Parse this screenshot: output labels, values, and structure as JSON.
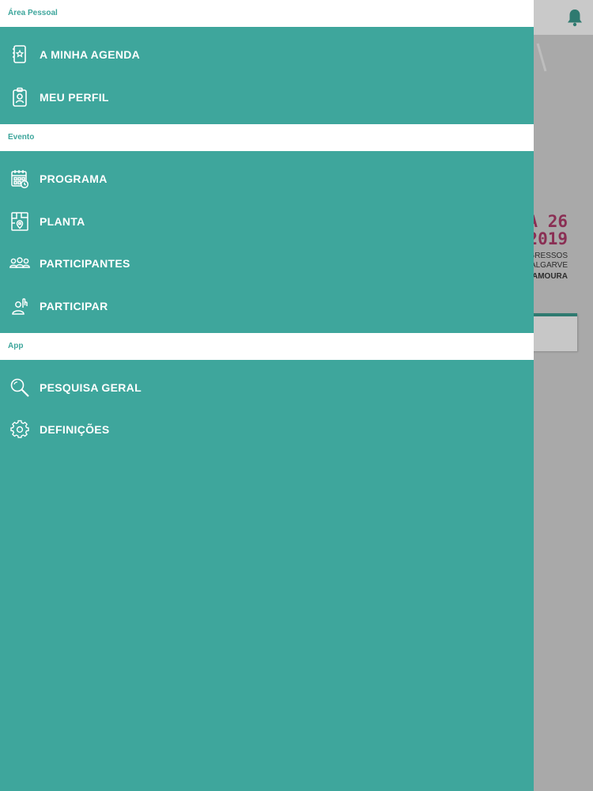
{
  "background": {
    "poster": {
      "line1": "A 26",
      "line2": "2019",
      "line3": "GRESSOS",
      "line4": "ALGARVE",
      "line5": "AMOURA"
    }
  },
  "drawer": {
    "sections": {
      "personal": {
        "header": "Área Pessoal",
        "items": [
          {
            "label": "A MINHA AGENDA",
            "icon": "agenda-icon"
          },
          {
            "label": "MEU PERFIL",
            "icon": "profile-badge-icon"
          }
        ]
      },
      "event": {
        "header": "Evento",
        "items": [
          {
            "label": "PROGRAMA",
            "icon": "calendar-icon"
          },
          {
            "label": "PLANTA",
            "icon": "map-icon"
          },
          {
            "label": "PARTICIPANTES",
            "icon": "people-icon"
          },
          {
            "label": "PARTICIPAR",
            "icon": "raise-hand-icon"
          }
        ]
      },
      "app": {
        "header": "App",
        "items": [
          {
            "label": "PESQUISA GERAL",
            "icon": "search-icon"
          },
          {
            "label": "DEFINIÇÕES",
            "icon": "gear-icon"
          }
        ]
      }
    }
  },
  "colors": {
    "drawer_bg": "#3ea69c",
    "header_text": "#3ea69c",
    "poster_accent": "#8a2f54"
  }
}
